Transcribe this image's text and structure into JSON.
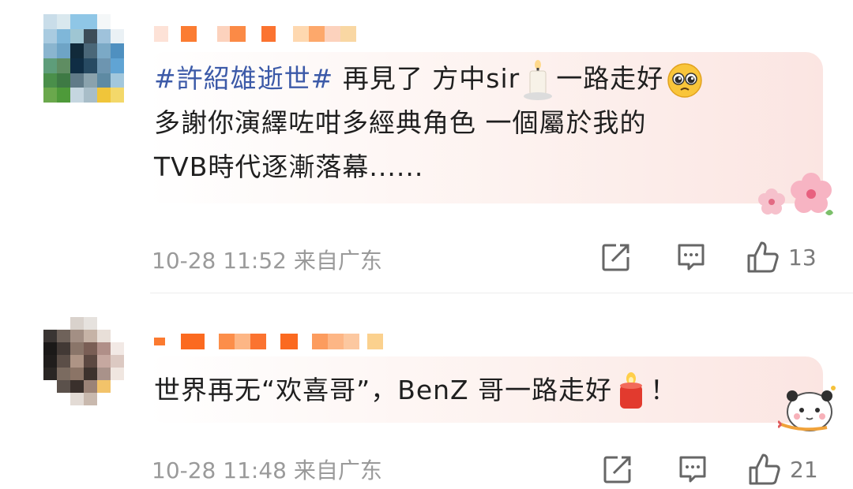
{
  "comments": [
    {
      "hashtag": "#許紹雄逝世#",
      "line1_text": "再見了 方中sir",
      "line1_tail": "一路走好",
      "line2": "多謝你演繹咗咁多經典角色 一個屬於我的",
      "line3": "TVB時代逐漸落幕......",
      "time": "10-28 11:52",
      "location": "来自广东",
      "likes": "13",
      "icons": [
        "candle-icon",
        "pleading-face-icon",
        "cherry-blossom-sticker"
      ]
    },
    {
      "text": "世界再无“欢喜哥”，BenZ 哥一路走好",
      "tail": "！",
      "time": "10-28 11:48",
      "location": "来自广东",
      "likes": "21",
      "icons": [
        "red-candle-icon",
        "panda-sticker"
      ]
    }
  ],
  "action_icons": [
    "share-icon",
    "comment-icon",
    "like-icon"
  ],
  "colors": {
    "hashtag": "#3c5aa8",
    "text": "#1f1f1f",
    "meta": "#9a9a9a",
    "bubble_tint": "#fbe5e2"
  }
}
